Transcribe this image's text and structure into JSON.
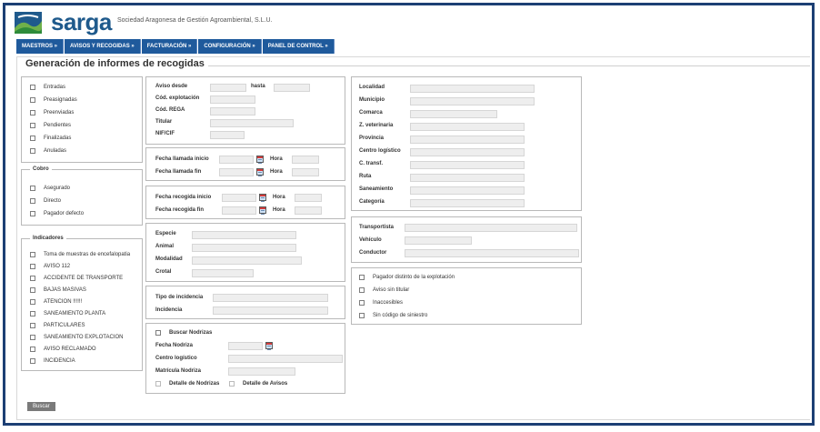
{
  "header": {
    "logo_text": "sarga",
    "tagline": "Sociedad Aragonesa de Gestión Agroambiental, S.L.U."
  },
  "nav": [
    "MAESTROS »",
    "AVISOS Y RECOGIDAS »",
    "FACTURACIÓN »",
    "CONFIGURACIÓN »",
    "PANEL DE CONTROL »"
  ],
  "page_title": "Generación de informes de recogidas",
  "estado": [
    "Entradas",
    "Preasignadas",
    "Preenviadas",
    "Pendientes",
    "Finalizadas",
    "Anuladas"
  ],
  "cobro": {
    "legend": "Cobro",
    "items": [
      "Asegurado",
      "Directo",
      "Pagador defecto"
    ]
  },
  "indicadores": {
    "legend": "Indicadores",
    "items": [
      "Toma de muestras de encefalopatia",
      "AVISO 112",
      "ACCIDENTE DE TRANSPORTE",
      "BAJAS MASIVAS",
      "ATENCION !!!!!!",
      "SANEAMIENTO PLANTA",
      "PARTICULARES",
      "SANEAMIENTO EXPLOTACION",
      "AVISO RECLAMADO",
      "INCIDENCIA"
    ]
  },
  "aviso": {
    "aviso_desde": "Aviso desde",
    "hasta": "hasta",
    "cod_explotacion": "Cód. explotación",
    "cod_rega": "Cód. REGA",
    "titular": "Titular",
    "nif_cif": "NIF/CIF"
  },
  "llamada": {
    "inicio": "Fecha llamada inicio",
    "fin": "Fecha llamada fin",
    "hora": "Hora"
  },
  "recogida": {
    "inicio": "Fecha recogida inicio",
    "fin": "Fecha recogida fin",
    "hora": "Hora"
  },
  "animal": {
    "especie": "Especie",
    "animal": "Animal",
    "modalidad": "Modalidad",
    "crotal": "Crotal"
  },
  "incidencia": {
    "tipo": "Tipo de incidencia",
    "incidencia": "Incidencia"
  },
  "nodrizas": {
    "buscar": "Buscar Nodrizas",
    "fecha": "Fecha Nodriza",
    "centro": "Centro logístico",
    "matricula": "Matrícula Nodriza",
    "detalle_nodrizas": "Detalle de Nodrizas",
    "detalle_avisos": "Detalle de Avisos"
  },
  "ubicacion": [
    "Localidad",
    "Municipio",
    "Comarca",
    "Z. veterinaria",
    "Provincia",
    "Centro logístico",
    "C. transf.",
    "Ruta",
    "Saneamiento",
    "Categoría"
  ],
  "transporte": [
    "Transportista",
    "Vehículo",
    "Conductor"
  ],
  "otros": [
    "Pagador distinto de la explotación",
    "Aviso sin titular",
    "Inaccesibles",
    "Sin código de siniestro"
  ],
  "buscar_button": "Buscar",
  "colors": {
    "brand": "#1f5a8c",
    "nav_bg": "#1f5a9c",
    "frame": "#1c3f74",
    "input_bg": "#eeeeee"
  }
}
